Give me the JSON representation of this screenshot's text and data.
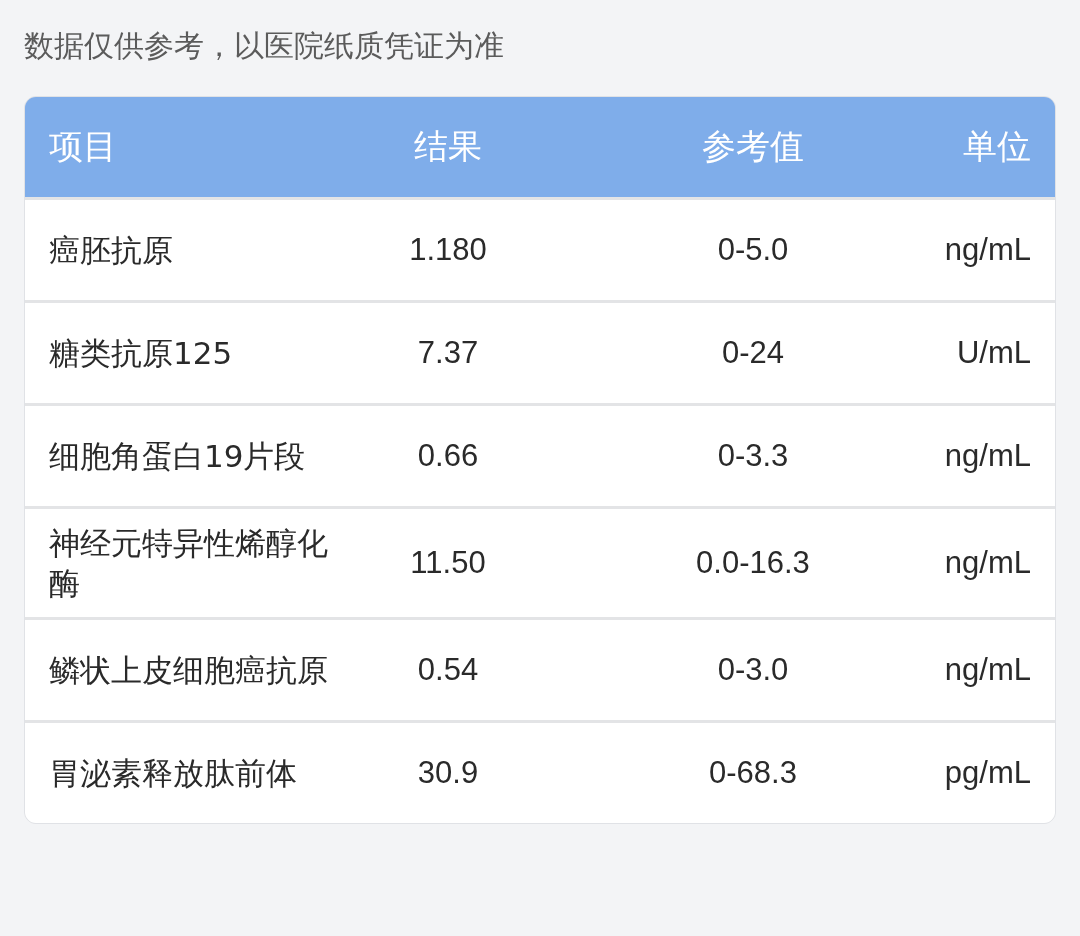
{
  "note": "数据仅供参考，以医院纸质凭证为准",
  "table": {
    "columns": [
      "项目",
      "结果",
      "参考值",
      "单位"
    ],
    "rows": [
      {
        "item": "癌胚抗原",
        "result": "1.180",
        "reference": "0-5.0",
        "unit": "ng/mL"
      },
      {
        "item": "糖类抗原125",
        "result": "7.37",
        "reference": "0-24",
        "unit": "U/mL"
      },
      {
        "item": "细胞角蛋白19片段",
        "result": "0.66",
        "reference": "0-3.3",
        "unit": "ng/mL"
      },
      {
        "item": "神经元特异性烯醇化酶",
        "result": "11.50",
        "reference": "0.0-16.3",
        "unit": "ng/mL"
      },
      {
        "item": "鳞状上皮细胞癌抗原",
        "result": "0.54",
        "reference": "0-3.0",
        "unit": "ng/mL"
      },
      {
        "item": "胃泌素释放肽前体",
        "result": "30.9",
        "reference": "0-68.3",
        "unit": "pg/mL"
      }
    ]
  }
}
